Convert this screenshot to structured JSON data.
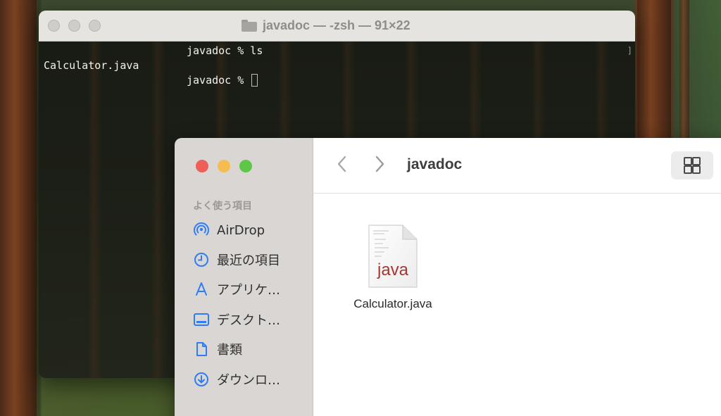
{
  "terminal": {
    "title": "javadoc — -zsh — 91×22",
    "lines": {
      "line1": "javadoc % ls",
      "line2": "Calculator.java",
      "line3": "javadoc % "
    },
    "scroll_mark": "]"
  },
  "finder": {
    "title": "javadoc",
    "nav": {
      "back_icon": "chevron-left-icon",
      "forward_icon": "chevron-right-icon"
    },
    "view_icon": "grid-view-icon",
    "sidebar": {
      "heading": "よく使う項目",
      "items": [
        {
          "label": "AirDrop",
          "icon": "airdrop-icon"
        },
        {
          "label": "最近の項目",
          "icon": "clock-icon"
        },
        {
          "label": "アプリケ…",
          "icon": "applications-icon"
        },
        {
          "label": "デスクト…",
          "icon": "desktop-icon"
        },
        {
          "label": "書類",
          "icon": "document-icon"
        },
        {
          "label": "ダウンロ…",
          "icon": "download-icon"
        }
      ]
    },
    "files": [
      {
        "name": "Calculator.java",
        "icon_text": "java"
      }
    ]
  },
  "colors": {
    "close": "#ed5f57",
    "minimize": "#f5bd4f",
    "zoom": "#5ec649",
    "sidebar_icon": "#2f7df6",
    "java_text": "#a8352f"
  }
}
